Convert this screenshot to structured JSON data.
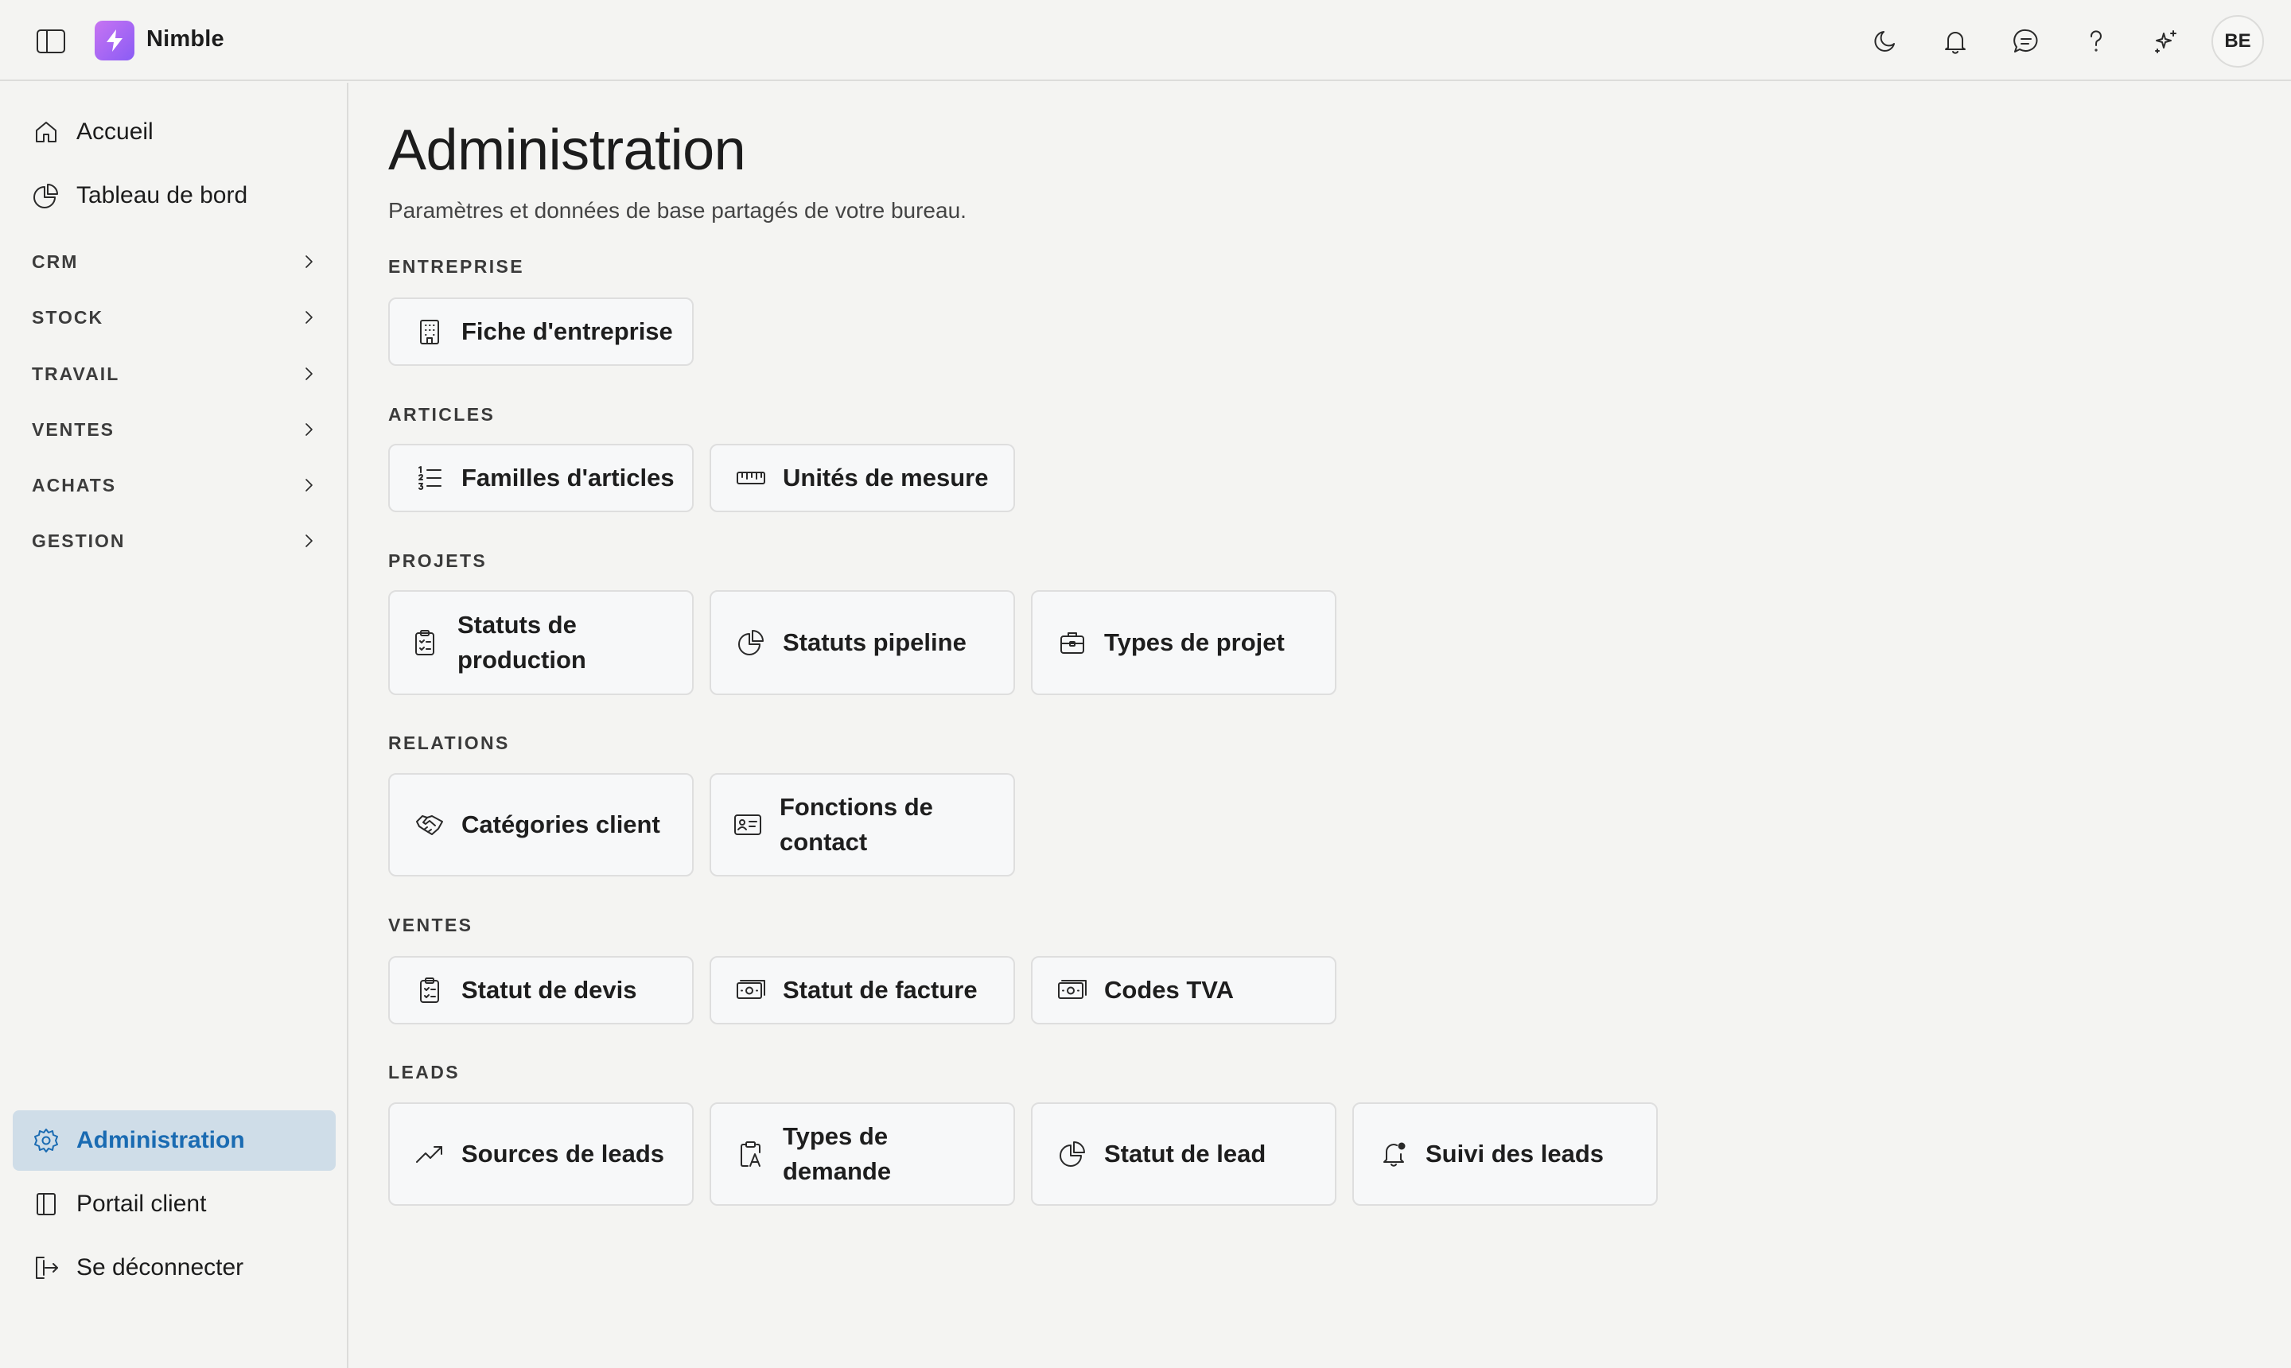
{
  "app": {
    "name": "Nimble",
    "avatar_initials": "BE",
    "brand_color": "#9b63f5"
  },
  "header": {
    "icons": [
      "moon-icon",
      "bell-icon",
      "chat-icon",
      "help-icon",
      "sparkles-icon"
    ]
  },
  "sidebar": {
    "top_items": [
      {
        "label": "Accueil",
        "icon": "home-icon"
      },
      {
        "label": "Tableau de bord",
        "icon": "pie-chart-icon"
      }
    ],
    "groups": [
      "CRM",
      "STOCK",
      "TRAVAIL",
      "VENTES",
      "ACHATS",
      "GESTION"
    ],
    "bottom_items": [
      {
        "label": "Administration",
        "icon": "gear-icon",
        "active": true
      },
      {
        "label": "Portail client",
        "icon": "book-icon"
      },
      {
        "label": "Se déconnecter",
        "icon": "logout-icon"
      }
    ],
    "active_color": "#1a6bb2"
  },
  "main": {
    "title": "Administration",
    "subtitle": "Paramètres et données de base partagés de votre bureau.",
    "sections": [
      {
        "title": "ENTREPRISE",
        "cards": [
          {
            "label": "Fiche d'entreprise",
            "icon": "building-icon"
          }
        ]
      },
      {
        "title": "ARTICLES",
        "cards": [
          {
            "label": "Familles d'articles",
            "icon": "list-ordered-icon"
          },
          {
            "label": "Unités de mesure",
            "icon": "ruler-icon"
          }
        ]
      },
      {
        "title": "PROJETS",
        "cards": [
          {
            "label": "Statuts de production",
            "icon": "clipboard-list-icon"
          },
          {
            "label": "Statuts pipeline",
            "icon": "pie-chart-icon"
          },
          {
            "label": "Types de projet",
            "icon": "briefcase-icon"
          }
        ]
      },
      {
        "title": "RELATIONS",
        "cards": [
          {
            "label": "Catégories client",
            "icon": "handshake-icon"
          },
          {
            "label": "Fonctions de contact",
            "icon": "id-card-icon"
          }
        ]
      },
      {
        "title": "VENTES",
        "cards": [
          {
            "label": "Statut de devis",
            "icon": "clipboard-check-icon"
          },
          {
            "label": "Statut de facture",
            "icon": "banknote-icon"
          },
          {
            "label": "Codes TVA",
            "icon": "banknote-icon"
          }
        ]
      },
      {
        "title": "LEADS",
        "cards": [
          {
            "label": "Sources de leads",
            "icon": "trending-up-icon"
          },
          {
            "label": "Types de demande",
            "icon": "clipboard-type-icon"
          },
          {
            "label": "Statut de lead",
            "icon": "pie-chart-icon"
          },
          {
            "label": "Suivi des leads",
            "icon": "bell-dot-icon"
          }
        ]
      }
    ]
  }
}
